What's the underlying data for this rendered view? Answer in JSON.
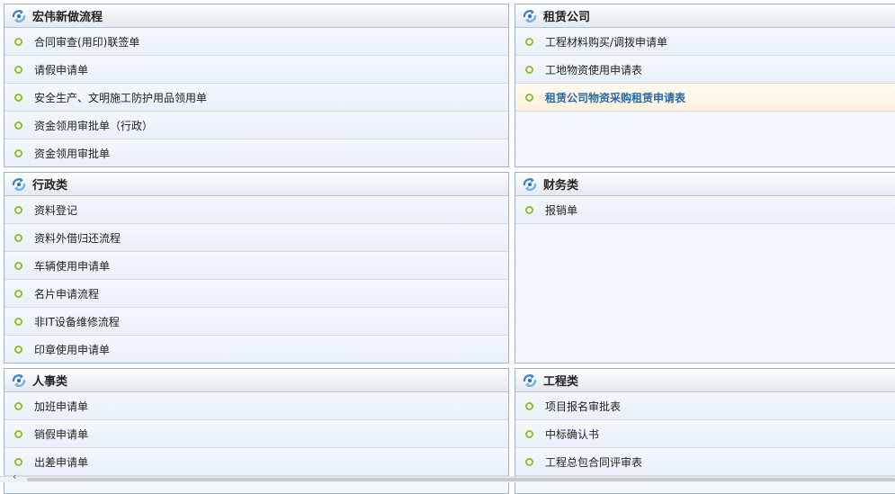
{
  "panels": [
    {
      "title": "宏伟新做流程",
      "items": [
        {
          "label": "合同审查(用印)联签单",
          "active": false
        },
        {
          "label": "请假申请单",
          "active": false
        },
        {
          "label": "安全生产、文明施工防护用品领用单",
          "active": false
        },
        {
          "label": "资金领用审批单（行政）",
          "active": false
        },
        {
          "label": "资金领用审批单",
          "active": false
        }
      ]
    },
    {
      "title": "租赁公司",
      "items": [
        {
          "label": "工程材料购买/调拨申请单",
          "active": false
        },
        {
          "label": "工地物资使用申请表",
          "active": false
        },
        {
          "label": "租赁公司物资采购租赁申请表",
          "active": true
        }
      ]
    },
    {
      "title": "行政类",
      "items": [
        {
          "label": "资料登记",
          "active": false
        },
        {
          "label": "资料外借归还流程",
          "active": false
        },
        {
          "label": "车辆使用申请单",
          "active": false
        },
        {
          "label": "名片申请流程",
          "active": false
        },
        {
          "label": "非IT设备维修流程",
          "active": false
        },
        {
          "label": "印章使用申请单",
          "active": false
        }
      ]
    },
    {
      "title": "财务类",
      "items": [
        {
          "label": "报销单",
          "active": false
        }
      ]
    },
    {
      "title": "人事类",
      "items": [
        {
          "label": "加班申请单",
          "active": false
        },
        {
          "label": "销假申请单",
          "active": false
        },
        {
          "label": "出差申请单",
          "active": false
        }
      ]
    },
    {
      "title": "工程类",
      "items": [
        {
          "label": "项目报名审批表",
          "active": false
        },
        {
          "label": "中标确认书",
          "active": false
        },
        {
          "label": "工程总包合同评审表",
          "active": false
        }
      ]
    }
  ],
  "colors": {
    "accent": "#2a6aa3",
    "bullet": "#8bbf2c",
    "border": "#9bb4cc",
    "active_bg": "#fdefdc"
  },
  "icons": {
    "panel_icon": "workflow-icon",
    "item_icon": "bullet-icon",
    "scroll_left": "scroll-left-arrow-icon"
  }
}
